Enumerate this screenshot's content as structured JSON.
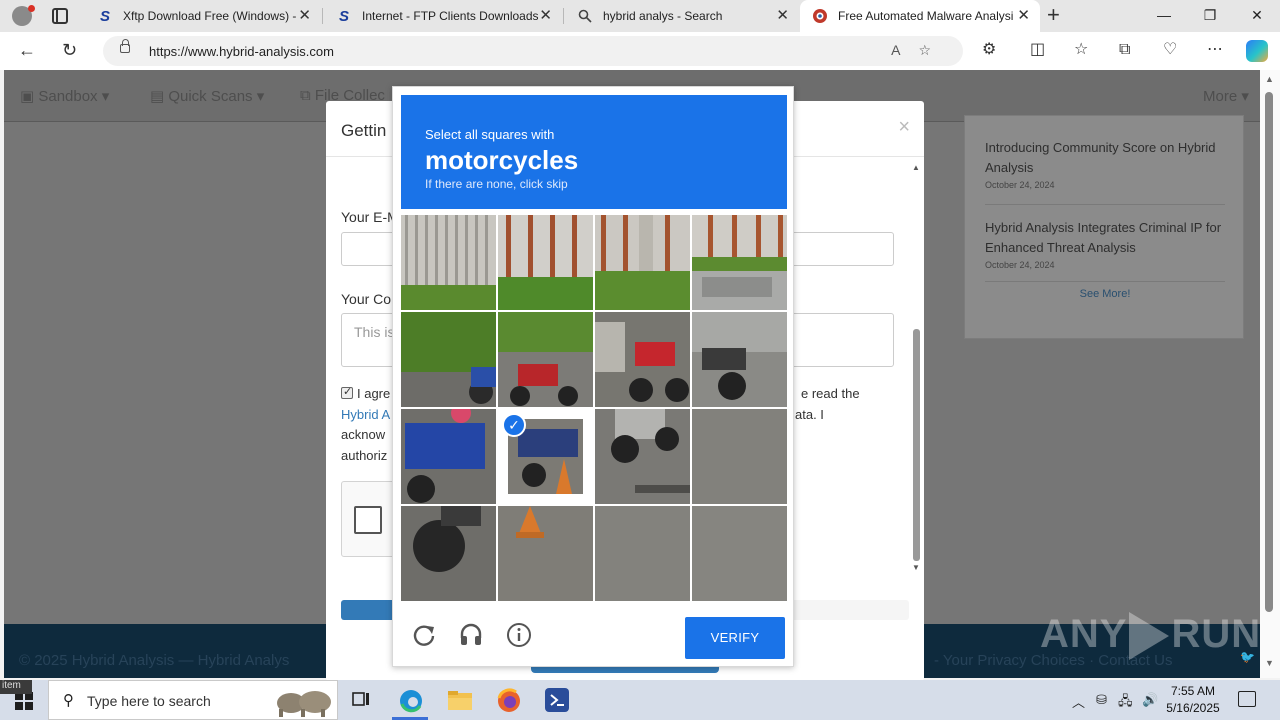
{
  "browser": {
    "tabs": [
      {
        "label": "Xftp Download Free (Windows) -",
        "favicon": "S"
      },
      {
        "label": "Internet - FTP Clients Downloads",
        "favicon": "S"
      },
      {
        "label": "hybrid analys - Search",
        "favicon": "search"
      },
      {
        "label": "Free Automated Malware Analysi",
        "favicon": "ha"
      }
    ],
    "url": "https://www.hybrid-analysis.com"
  },
  "site": {
    "nav": {
      "sandbox": "Sandbox",
      "quick_scans": "Quick Scans",
      "file_collections": "File Collec",
      "more": "More"
    },
    "news": [
      {
        "title": "Introducing Community Score on Hybrid Analysis",
        "date": "October 24, 2024"
      },
      {
        "title": "Hybrid Analysis Integrates Criminal IP for Enhanced Threat Analysis",
        "date": "October 24, 2024"
      }
    ],
    "see_more": "See More!",
    "footer_left": "© 2025 Hybrid Analysis — Hybrid Analys",
    "footer_right": "- Your Privacy Choices",
    "footer_contact": "Contact Us"
  },
  "modal": {
    "title": "Gettin",
    "email_label": "Your E-M",
    "comment_label": "Your Co",
    "comment_placeholder": "This is",
    "agree_line1_a": "I agre",
    "agree_line1_b": "e read the",
    "agree_link": "Hybrid A",
    "agree_line2_b": "ata. I",
    "agree_line3": "acknow",
    "agree_line4": "authoriz"
  },
  "captcha": {
    "prompt_sub": "Select all squares with",
    "prompt_main": "motorcycles",
    "prompt_hint": "If there are none, click skip",
    "verify_label": "VERIFY",
    "selected_cell": 5,
    "accent": "#1a73e8"
  },
  "watermark": {
    "left": "ANY",
    "right": "RUN"
  },
  "taskbar": {
    "search_placeholder": "Type here to search",
    "time": "7:55 AM",
    "date": "5/16/2025"
  },
  "ticker": "item"
}
